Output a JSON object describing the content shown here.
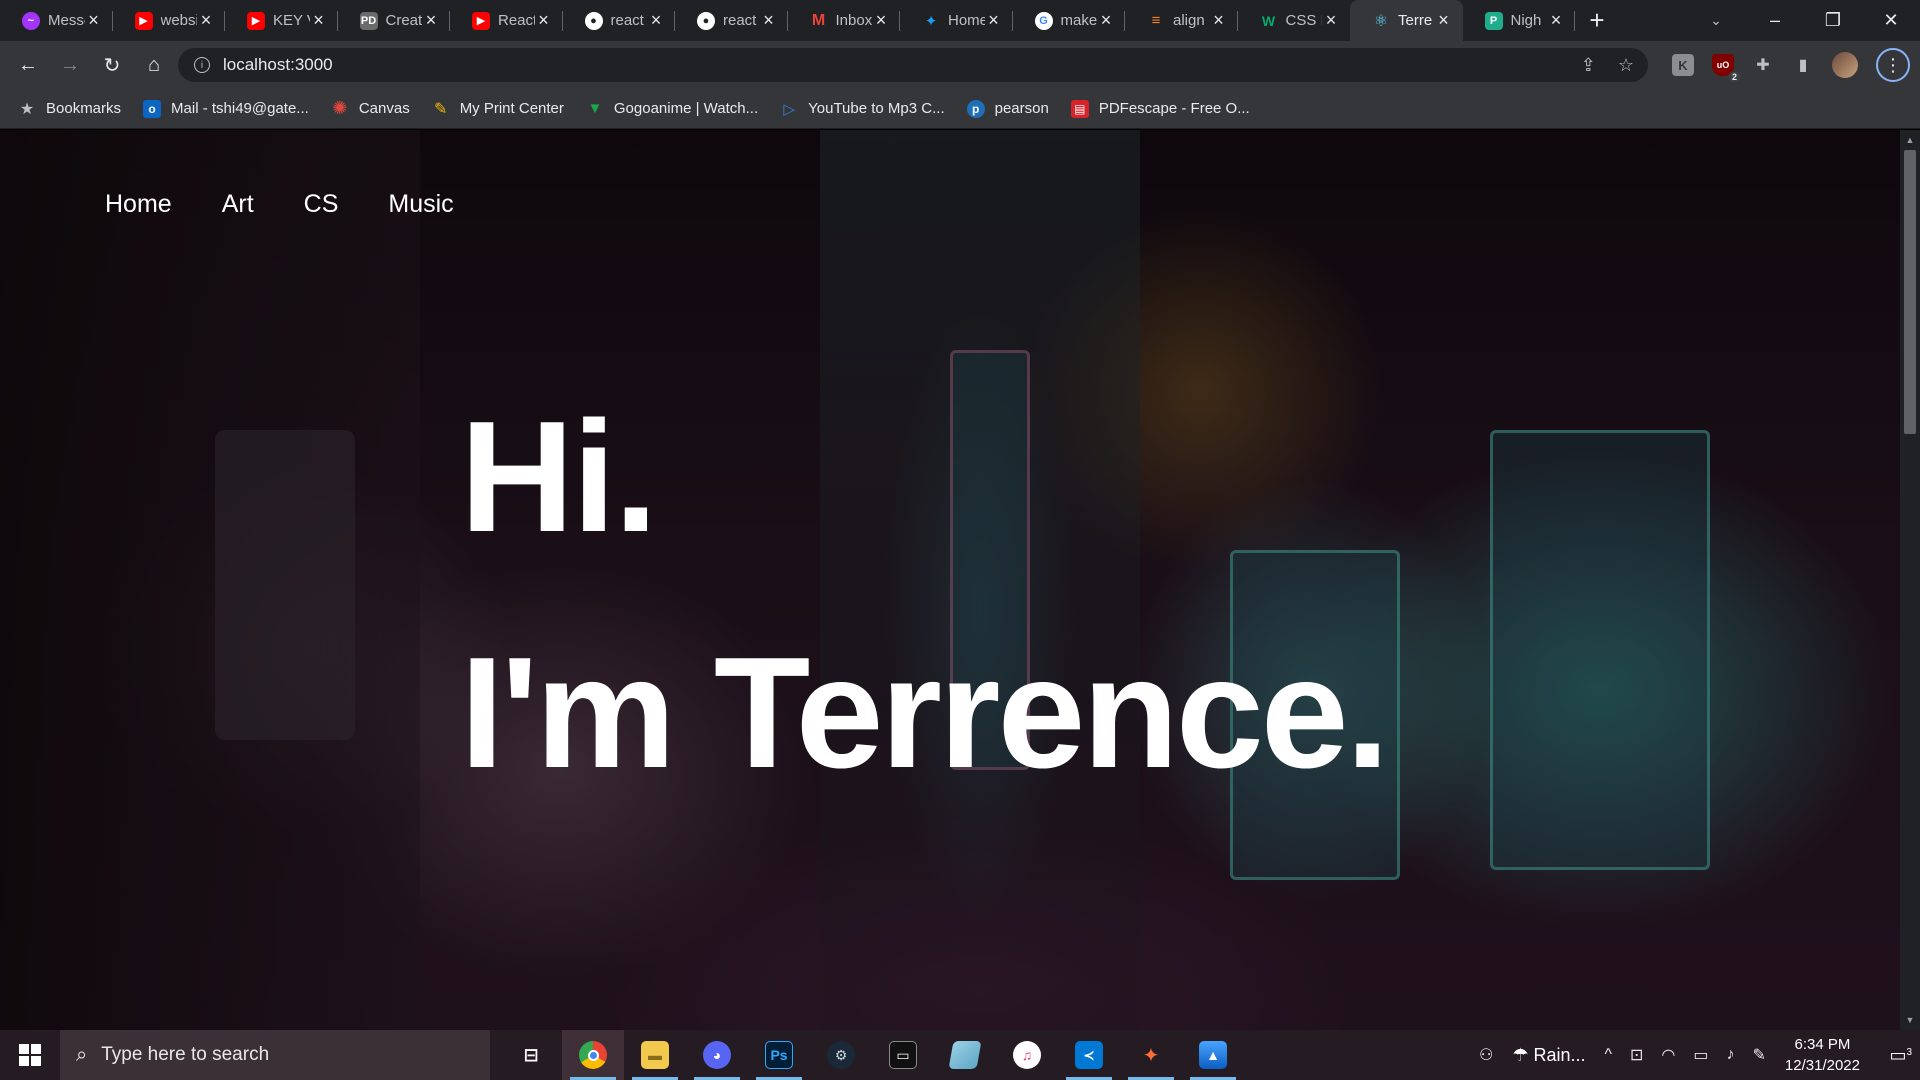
{
  "browser": {
    "tabs": [
      {
        "title": "Messenger",
        "icon": "messenger-icon",
        "color": "#a334fa"
      },
      {
        "title": "website",
        "icon": "youtube-icon",
        "color": "#ff0000"
      },
      {
        "title": "KEY V",
        "icon": "youtube-icon",
        "color": "#ff0000"
      },
      {
        "title": "Create",
        "icon": "pd-icon",
        "color": "#6b6b6b"
      },
      {
        "title": "React",
        "icon": "youtube-icon",
        "color": "#ff0000"
      },
      {
        "title": "react",
        "icon": "github-icon",
        "color": "#ffffff"
      },
      {
        "title": "react",
        "icon": "github-icon",
        "color": "#ffffff"
      },
      {
        "title": "Inbox",
        "icon": "gmail-icon",
        "color": "#ea4335"
      },
      {
        "title": "Home",
        "icon": "twitter-icon",
        "color": "#1d9bf0"
      },
      {
        "title": "make",
        "icon": "google-icon",
        "color": "#4285f4"
      },
      {
        "title": "align",
        "icon": "stackoverflow-icon",
        "color": "#f48024"
      },
      {
        "title": "CSS I",
        "icon": "w3schools-icon",
        "color": "#04aa6d"
      },
      {
        "title": "Terre",
        "icon": "react-icon",
        "color": "#61dafb",
        "active": true
      },
      {
        "title": "Nigh",
        "icon": "page-icon",
        "color": "#1fae8b"
      }
    ],
    "url": "localhost:3000",
    "bookmarks": [
      {
        "label": "Bookmarks",
        "icon": "star-icon",
        "color": "#9aa0a6"
      },
      {
        "label": "Mail - tshi49@gate...",
        "icon": "outlook-icon",
        "color": "#0a66c2"
      },
      {
        "label": "Canvas",
        "icon": "canvas-icon",
        "color": "#e2463c"
      },
      {
        "label": "My Print Center",
        "icon": "print-icon",
        "color": "#f2b705"
      },
      {
        "label": "Gogoanime | Watch...",
        "icon": "gogoanime-icon",
        "color": "#19a84a"
      },
      {
        "label": "YouTube to Mp3 C...",
        "icon": "play-icon",
        "color": "#3b7ddd"
      },
      {
        "label": "pearson",
        "icon": "pearson-icon",
        "color": "#1e6fb8"
      },
      {
        "label": "PDFescape - Free O...",
        "icon": "pdfescape-icon",
        "color": "#d8232a"
      }
    ],
    "extensions": {
      "ublock_badge": "2"
    }
  },
  "site": {
    "nav": [
      "Home",
      "Art",
      "CS",
      "Music"
    ],
    "hero_line1": "Hi.",
    "hero_line2": "I'm Terrence."
  },
  "taskbar": {
    "search_placeholder": "Type here to search",
    "apps": [
      {
        "name": "chrome",
        "open": true,
        "active": true
      },
      {
        "name": "file-explorer",
        "open": true
      },
      {
        "name": "discord",
        "open": true
      },
      {
        "name": "photoshop",
        "open": true
      },
      {
        "name": "steam",
        "open": false
      },
      {
        "name": "terminal",
        "open": false
      },
      {
        "name": "notes",
        "open": false
      },
      {
        "name": "itunes",
        "open": false
      },
      {
        "name": "vscode",
        "open": true
      },
      {
        "name": "jump-app",
        "open": true
      },
      {
        "name": "photos",
        "open": true
      }
    ],
    "weather": "Rain...",
    "time": "6:34 PM",
    "date": "12/31/2022",
    "notifications": "3"
  }
}
